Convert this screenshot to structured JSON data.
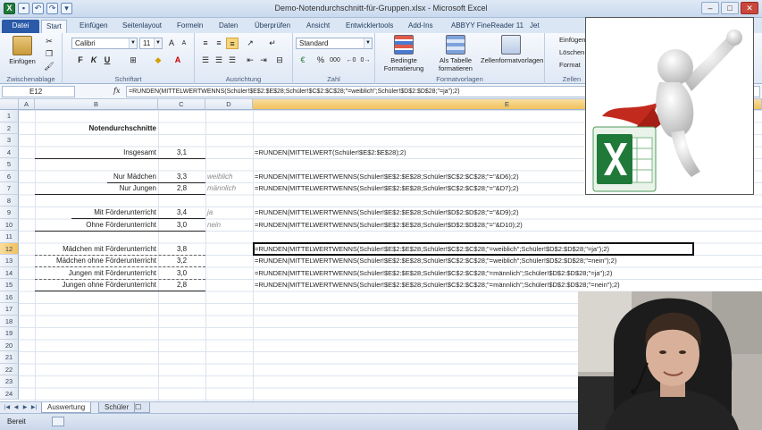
{
  "window": {
    "title": "Demo-Notendurchschnitt-für-Gruppen.xlsx - Microsoft Excel"
  },
  "ribbon": {
    "tabs": [
      "Datei",
      "Start",
      "Einfügen",
      "Seitenlayout",
      "Formeln",
      "Daten",
      "Überprüfen",
      "Ansicht",
      "Entwicklertools",
      "Add-Ins",
      "ABBYY FineReader 11",
      "Jet"
    ],
    "clipboard": {
      "paste_label": "Einfügen",
      "group": "Zwischenablage"
    },
    "font": {
      "name": "Calibri",
      "size": "11",
      "bold": "F",
      "italic": "K",
      "underline": "U",
      "group": "Schriftart"
    },
    "alignment": {
      "group": "Ausrichtung"
    },
    "number": {
      "format": "Standard",
      "group": "Zahl",
      "percent": "%",
      "thousands": "000"
    },
    "styles": {
      "conditional": "Bedingte Formatierung",
      "as_table": "Als Tabelle formatieren",
      "cell_styles": "Zellenformatvorlagen",
      "group": "Formatvorlagen"
    },
    "cells": {
      "insert": "Einfügen",
      "delete": "Löschen",
      "format": "Format",
      "group": "Zellen"
    }
  },
  "formula_bar": {
    "name_box": "E12",
    "fx": "fx",
    "formula": "=RUNDEN(MITTELWERTWENNS(Schüler!$E$2:$E$28;Schüler!$C$2:$C$28;\"=weiblich\";Schüler!$D$2:$D$28;\"=ja\");2)"
  },
  "columns": [
    "A",
    "B",
    "C",
    "D",
    "E"
  ],
  "rows": [
    "1",
    "2",
    "3",
    "4",
    "5",
    "6",
    "7",
    "8",
    "9",
    "10",
    "11",
    "12",
    "13",
    "14",
    "15",
    "16",
    "17",
    "18",
    "19",
    "20",
    "21",
    "22",
    "23",
    "24"
  ],
  "cells": {
    "title": "Notendurchschnitte",
    "r4": {
      "label": "Insgesamt",
      "value": "3,1",
      "formula": "=RUNDEN(MITTELWERT(Schüler!$E$2:$E$28);2)"
    },
    "r6": {
      "label": "Nur Mädchen",
      "value": "3,3",
      "crit": "weiblich",
      "formula": "=RUNDEN(MITTELWERTWENNS(Schüler!$E$2:$E$28;Schüler!$C$2:$C$28;\"=\"&D6);2)"
    },
    "r7": {
      "label": "Nur Jungen",
      "value": "2,8",
      "crit": "männlich",
      "formula": "=RUNDEN(MITTELWERTWENNS(Schüler!$E$2:$E$28;Schüler!$C$2:$C$28;\"=\"&D7);2)"
    },
    "r9": {
      "label": "Mit Förderunterricht",
      "value": "3,4",
      "crit": "ja",
      "formula": "=RUNDEN(MITTELWERTWENNS(Schüler!$E$2:$E$28;Schüler!$D$2:$D$28;\"=\"&D9);2)"
    },
    "r10": {
      "label": "Ohne Förderunterricht",
      "value": "3,0",
      "crit": "nein",
      "formula": "=RUNDEN(MITTELWERTWENNS(Schüler!$E$2:$E$28;Schüler!$D$2:$D$28;\"=\"&D10);2)"
    },
    "r12": {
      "label": "Mädchen mit Förderunterricht",
      "value": "3,8",
      "formula": "=RUNDEN(MITTELWERTWENNS(Schüler!$E$2:$E$28;Schüler!$C$2:$C$28;\"=weiblich\";Schüler!$D$2:$D$28;\"=ja\");2)"
    },
    "r13": {
      "label": "Mädchen ohne Förderunterricht",
      "value": "3,2",
      "formula": "=RUNDEN(MITTELWERTWENNS(Schüler!$E$2:$E$28;Schüler!$C$2:$C$28;\"=weiblich\";Schüler!$D$2:$D$28;\"=nein\");2)"
    },
    "r14": {
      "label": "Jungen mit Förderunterricht",
      "value": "3,0",
      "formula": "=RUNDEN(MITTELWERTWENNS(Schüler!$E$2:$E$28;Schüler!$C$2:$C$28;\"=männlich\";Schüler!$D$2:$D$28;\"=ja\");2)"
    },
    "r15": {
      "label": "Jungen ohne Förderunterricht",
      "value": "2,8",
      "formula": "=RUNDEN(MITTELWERTWENNS(Schüler!$E$2:$E$28;Schüler!$C$2:$C$28;\"=männlich\";Schüler!$D$2:$D$28;\"=nein\");2)"
    }
  },
  "sheets": [
    "Auswertung",
    "Schüler"
  ],
  "status": {
    "mode": "Bereit"
  },
  "colors": {
    "excel_green": "#1f7a3a",
    "file_tab": "#2b5aa8",
    "selection": "#f1c15c"
  }
}
